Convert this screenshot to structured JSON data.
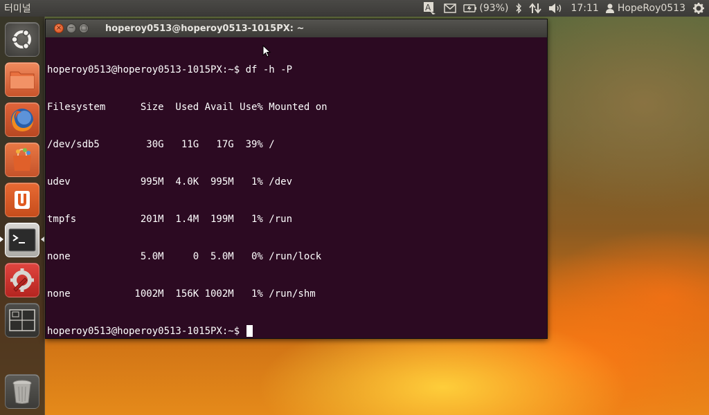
{
  "top_panel": {
    "app_title": "터미널",
    "keyboard_indicator": "A",
    "battery": "(93%)",
    "time": "17:11",
    "user": "HopeRoy0513"
  },
  "launcher": {
    "items": [
      {
        "name": "dash-home",
        "icon": "ubuntu-logo-icon"
      },
      {
        "name": "home-folder",
        "icon": "folder-icon"
      },
      {
        "name": "firefox",
        "icon": "firefox-icon"
      },
      {
        "name": "software-center",
        "icon": "shopping-bag-icon"
      },
      {
        "name": "ubuntu-one",
        "icon": "ubuntu-one-icon"
      },
      {
        "name": "terminal",
        "icon": "terminal-icon",
        "active": true
      },
      {
        "name": "system-settings",
        "icon": "settings-wrench-icon"
      },
      {
        "name": "workspace-switcher",
        "icon": "workspace-icon"
      },
      {
        "name": "trash",
        "icon": "trash-icon"
      }
    ]
  },
  "terminal": {
    "window_title": "hoperoy0513@hoperoy0513-1015PX: ~",
    "lines": [
      "hoperoy0513@hoperoy0513-1015PX:~$ df -h -P",
      "Filesystem      Size  Used Avail Use% Mounted on",
      "/dev/sdb5        30G   11G   17G  39% /",
      "udev            995M  4.0K  995M   1% /dev",
      "tmpfs           201M  1.4M  199M   1% /run",
      "none            5.0M     0  5.0M   0% /run/lock",
      "none           1002M  156K 1002M   1% /run/shm"
    ],
    "prompt": "hoperoy0513@hoperoy0513-1015PX:~$ "
  },
  "colors": {
    "terminal_bg": "#2c0a22",
    "close_button": "#e2572a"
  }
}
